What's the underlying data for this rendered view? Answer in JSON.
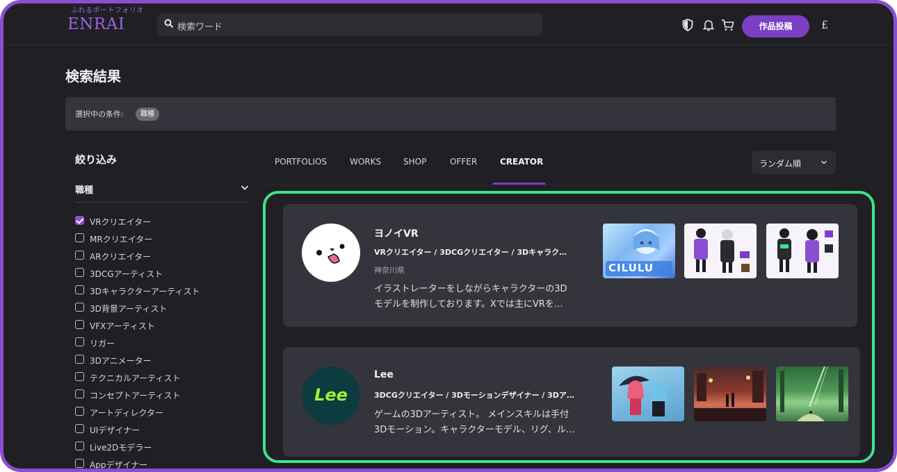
{
  "header": {
    "tagline": "ふれるポートフォリオ",
    "logo": "ENRAI",
    "search_placeholder": "検索ワード",
    "post_button": "作品投稿",
    "lang_icon": "£",
    "icons": [
      "shield-icon",
      "bell-icon",
      "cart-icon"
    ]
  },
  "page": {
    "title": "検索結果",
    "conditions_label": "選択中の条件:",
    "condition_chip": "職種"
  },
  "sidebar": {
    "title": "絞り込み",
    "group_label": "職種",
    "options": [
      {
        "label": "VRクリエイター",
        "checked": true
      },
      {
        "label": "MRクリエイター",
        "checked": false
      },
      {
        "label": "ARクリエイター",
        "checked": false
      },
      {
        "label": "3DCGアーティスト",
        "checked": false
      },
      {
        "label": "3Dキャラクターアーティスト",
        "checked": false
      },
      {
        "label": "3D背景アーティスト",
        "checked": false
      },
      {
        "label": "VFXアーティスト",
        "checked": false
      },
      {
        "label": "リガー",
        "checked": false
      },
      {
        "label": "3Dアニメーター",
        "checked": false
      },
      {
        "label": "テクニカルアーティスト",
        "checked": false
      },
      {
        "label": "コンセプトアーティスト",
        "checked": false
      },
      {
        "label": "アートディレクター",
        "checked": false
      },
      {
        "label": "UIデザイナー",
        "checked": false
      },
      {
        "label": "Live2Dモデラー",
        "checked": false
      },
      {
        "label": "Appデザイナー",
        "checked": false
      }
    ]
  },
  "tabs": [
    {
      "label": "PORTFOLIOS",
      "active": false
    },
    {
      "label": "WORKS",
      "active": false
    },
    {
      "label": "SHOP",
      "active": false
    },
    {
      "label": "OFFER",
      "active": false
    },
    {
      "label": "CREATOR",
      "active": true
    }
  ],
  "sort": {
    "value": "ランダム順"
  },
  "creators": [
    {
      "name": "ヨノイVR",
      "roles": "VRクリエイター / 3DCGクリエイター / 3Dキャラク…",
      "location": "神奈川県",
      "desc_line1": "イラストレーターをしながらキャラクターの3D",
      "desc_line2": "モデルを制作しております。Xでは主にVRを…",
      "thumb_label": "CILULU"
    },
    {
      "name": "Lee",
      "roles": "3DCGクリエイター / 3Dモーションデザイナー / 3Dア…",
      "location": "",
      "desc_line1": "ゲームの3Dアーティスト。 メインスキルは手付",
      "desc_line2": "3Dモーション。キャラクターモデル、リグ、ル…",
      "avatar_text": "Lee"
    }
  ],
  "colors": {
    "accent": "#7b3fc4",
    "highlight": "#3fe38a",
    "background": "#1f1f24",
    "card": "#34343c"
  }
}
